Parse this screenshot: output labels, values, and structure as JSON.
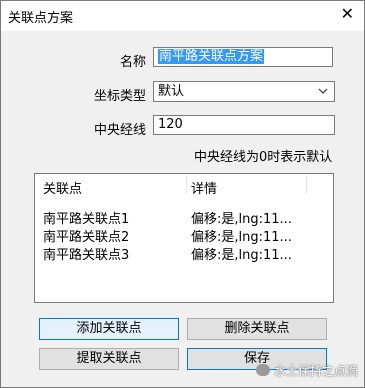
{
  "window": {
    "title": "关联点方案",
    "close_glyph": "✕"
  },
  "form": {
    "name_label": "名称",
    "name_value": "南平路关联点方案",
    "coord_type_label": "坐标类型",
    "coord_type_value": "默认",
    "central_meridian_label": "中央经线",
    "central_meridian_value": "120",
    "hint": "中央经线为0时表示默认"
  },
  "list": {
    "columns": [
      "关联点",
      "详情"
    ],
    "rows": [
      [
        "南平路关联点1",
        "偏移:是,lng:11..."
      ],
      [
        "南平路关联点2",
        "偏移:是,lng:11..."
      ],
      [
        "南平路关联点3",
        "偏移:是,lng:11..."
      ]
    ]
  },
  "buttons": {
    "add": "添加关联点",
    "delete": "删除关联点",
    "extract": "提取关联点",
    "save": "保存"
  },
  "watermark": {
    "text": "水土保持之点滴",
    "icon": "wechat-icon"
  }
}
